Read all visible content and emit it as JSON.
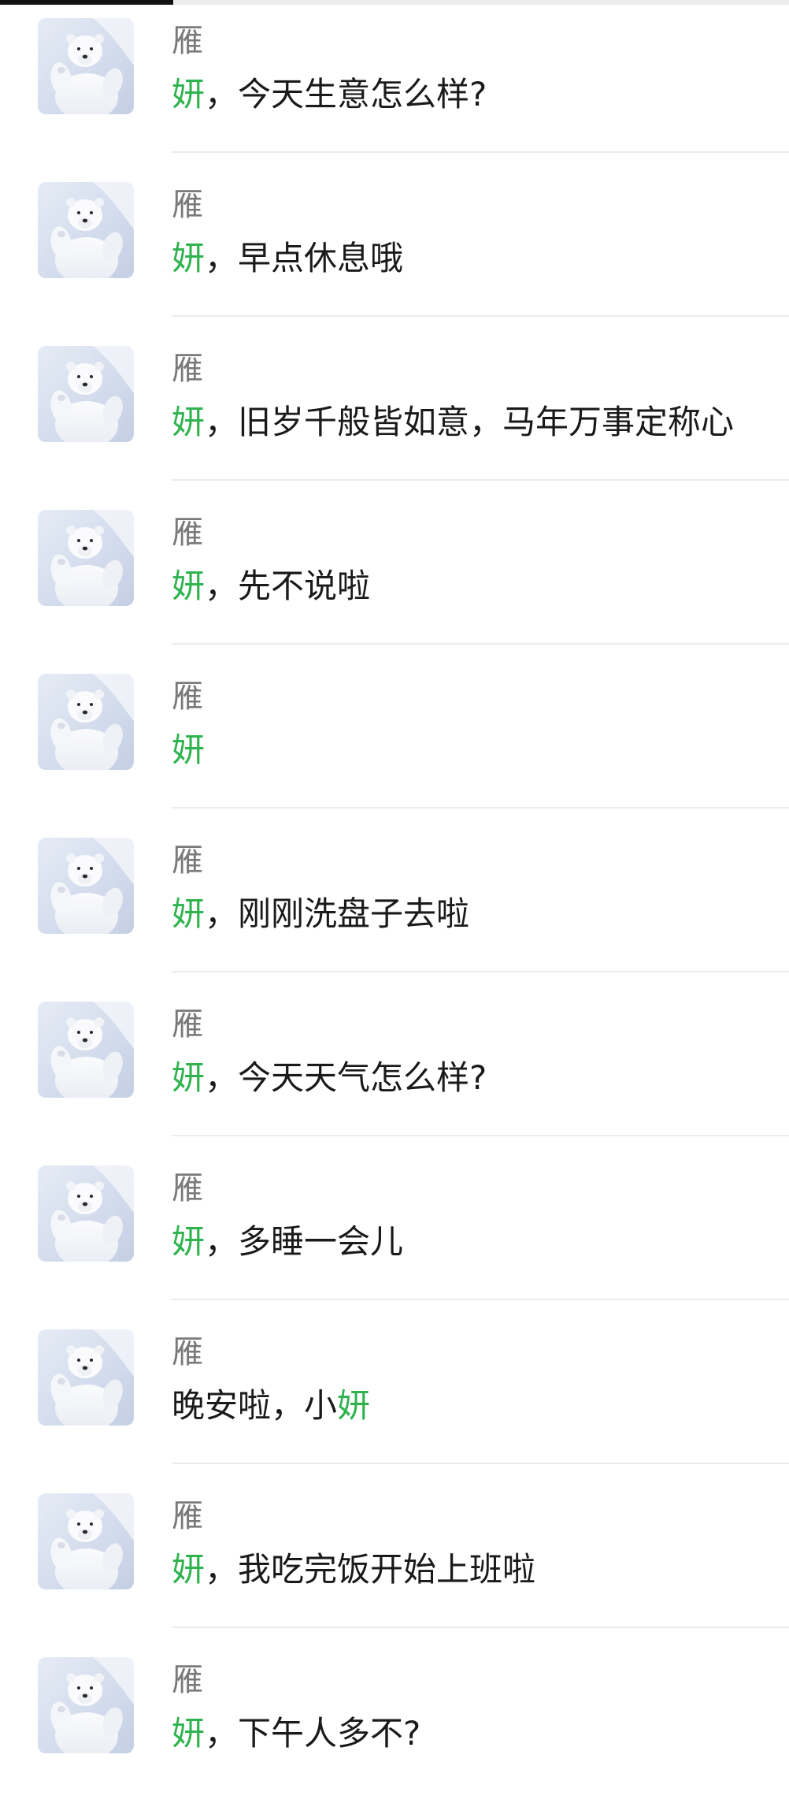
{
  "scroll_progress": 0.22,
  "colors": {
    "highlight": "#2fb34f",
    "sender": "#7a7a7a",
    "text": "#1a1a1a",
    "divider": "#ececec"
  },
  "avatar_icon": "polar-bear-avatar",
  "messages": [
    {
      "sender": "雁",
      "parts": [
        {
          "text": "妍",
          "highlight": true
        },
        {
          "text": "，今天生意怎么样?",
          "highlight": false
        }
      ]
    },
    {
      "sender": "雁",
      "parts": [
        {
          "text": "妍",
          "highlight": true
        },
        {
          "text": "，早点休息哦",
          "highlight": false
        }
      ]
    },
    {
      "sender": "雁",
      "parts": [
        {
          "text": "妍",
          "highlight": true
        },
        {
          "text": "，旧岁千般皆如意，马年万事定称心",
          "highlight": false
        }
      ]
    },
    {
      "sender": "雁",
      "parts": [
        {
          "text": "妍",
          "highlight": true
        },
        {
          "text": "，先不说啦",
          "highlight": false
        }
      ]
    },
    {
      "sender": "雁",
      "parts": [
        {
          "text": "妍",
          "highlight": true
        }
      ]
    },
    {
      "sender": "雁",
      "parts": [
        {
          "text": "妍",
          "highlight": true
        },
        {
          "text": "，刚刚洗盘子去啦",
          "highlight": false
        }
      ]
    },
    {
      "sender": "雁",
      "parts": [
        {
          "text": "妍",
          "highlight": true
        },
        {
          "text": "，今天天气怎么样?",
          "highlight": false
        }
      ]
    },
    {
      "sender": "雁",
      "parts": [
        {
          "text": "妍",
          "highlight": true
        },
        {
          "text": "，多睡一会儿",
          "highlight": false
        }
      ]
    },
    {
      "sender": "雁",
      "parts": [
        {
          "text": "晚安啦，小",
          "highlight": false
        },
        {
          "text": "妍",
          "highlight": true
        }
      ]
    },
    {
      "sender": "雁",
      "parts": [
        {
          "text": "妍",
          "highlight": true
        },
        {
          "text": "，我吃完饭开始上班啦",
          "highlight": false
        }
      ]
    },
    {
      "sender": "雁",
      "parts": [
        {
          "text": "妍",
          "highlight": true
        },
        {
          "text": "，下午人多不?",
          "highlight": false
        }
      ]
    }
  ]
}
